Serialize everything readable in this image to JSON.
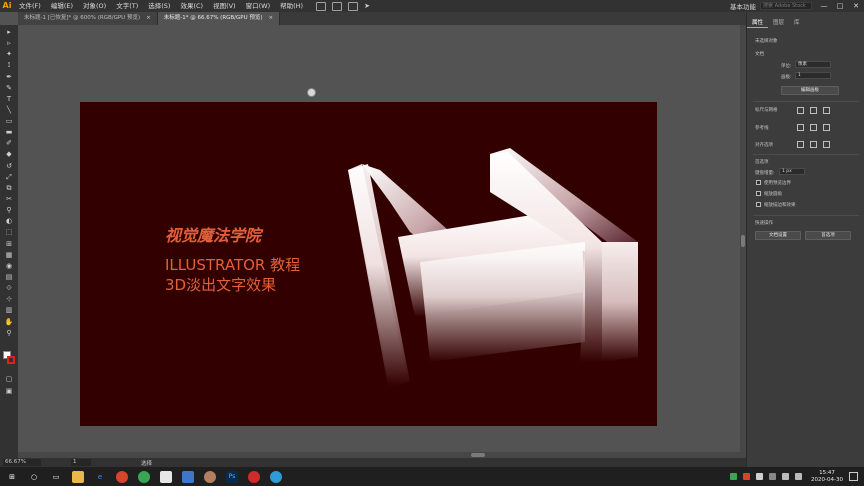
{
  "app": {
    "logo": "Ai"
  },
  "menu": [
    "文件(F)",
    "编辑(E)",
    "对象(O)",
    "文字(T)",
    "选择(S)",
    "效果(C)",
    "视图(V)",
    "窗口(W)",
    "帮助(H)"
  ],
  "header_right": {
    "workspace": "基本功能",
    "stock_search": "搜索 Adobe Stock",
    "win_controls": [
      "—",
      "□",
      "✕"
    ]
  },
  "tabs": [
    {
      "label": "未标题-1 [已恢复]* @ 600% (RGB/GPU 预览)",
      "close": "×"
    },
    {
      "label": "未标题-1* @ 66.67% (RGB/GPU 预览)",
      "close": "×"
    }
  ],
  "toolbar_icons": [
    "▸",
    "▹",
    "✦",
    "⟟",
    "✒",
    "✎",
    "T",
    "╲",
    "▭",
    "▬",
    "✐",
    "◆",
    "↺",
    "⤢",
    "⧉",
    "✂",
    "⚲",
    "◐",
    "⬚",
    "⊞",
    "▦",
    "◉",
    "▤",
    "⟐",
    "⊹",
    "▥",
    "✋",
    "⚲",
    "▢"
  ],
  "artboard": {
    "title": "视觉魔法学院",
    "subtitle_1": "ILLUSTRATOR 教程",
    "subtitle_2": "3D淡出文字效果",
    "background": "#330000",
    "text_color": "#e0603a"
  },
  "status": {
    "zoom": "66.67%",
    "page": "1",
    "tool": "选择"
  },
  "panel": {
    "tabs": [
      "属性",
      "图层",
      "库"
    ],
    "no_selection": "未选择对象",
    "document_label": "文档",
    "units_label": "单位:",
    "units_value": "像素",
    "artboard_label": "画板:",
    "artboard_value": "1",
    "edit_artboard_btn": "编辑画板",
    "rulers_grids_label": "标尺与网格",
    "guides_label": "参考线",
    "snap_options_label": "对齐选项",
    "preferences_label": "首选项",
    "keyboard_increment_label": "键盘增量:",
    "keyboard_increment_value": "1 px",
    "checkboxes": [
      "使用预览边界",
      "缩放圆角",
      "缩放描边和效果"
    ],
    "quick_actions_label": "快速操作",
    "doc_setup_btn": "文档设置",
    "preferences_btn": "首选项"
  },
  "taskbar": {
    "time": "15:47",
    "date": "2020-04-30"
  }
}
